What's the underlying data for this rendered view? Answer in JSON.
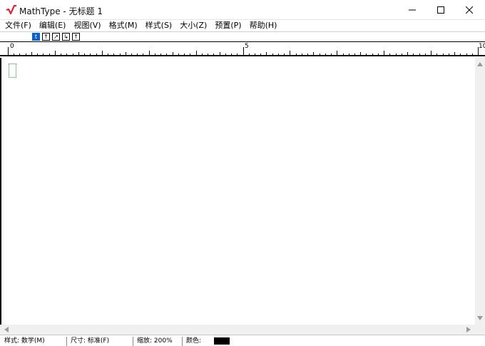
{
  "window": {
    "title": "MathType - 无标题 1",
    "icon": "mathtype-radical-icon",
    "controls": [
      "minimize-icon",
      "maximize-icon",
      "close-icon"
    ]
  },
  "menu": {
    "items": [
      "文件(F)",
      "编辑(E)",
      "视图(V)",
      "格式(M)",
      "样式(S)",
      "大小(Z)",
      "预置(P)",
      "帮助(H)"
    ]
  },
  "toolbar": {
    "buttons": [
      {
        "glyph": "t",
        "icon": "nudge-tab-icon",
        "active": true
      },
      {
        "glyph": "↑",
        "icon": "nudge-up-icon",
        "active": false
      },
      {
        "glyph": "↗",
        "icon": "nudge-up-right-icon",
        "active": false
      },
      {
        "glyph": "↳",
        "icon": "nudge-down-right-icon",
        "active": false
      },
      {
        "glyph": "↑",
        "icon": "nudge-up-alt-icon",
        "active": false
      }
    ]
  },
  "ruler": {
    "labels": [
      "0",
      "5",
      "10"
    ]
  },
  "status": {
    "style": "样式: 数学(M)",
    "size": "尺寸: 标准(F)",
    "zoom": "缩放: 200%",
    "color_label": "颜色:",
    "color_value": "#000000"
  },
  "colors": {
    "accent": "#0b63c5",
    "placeholder_box": "#2a9a2a",
    "logo": "#d3263a"
  }
}
